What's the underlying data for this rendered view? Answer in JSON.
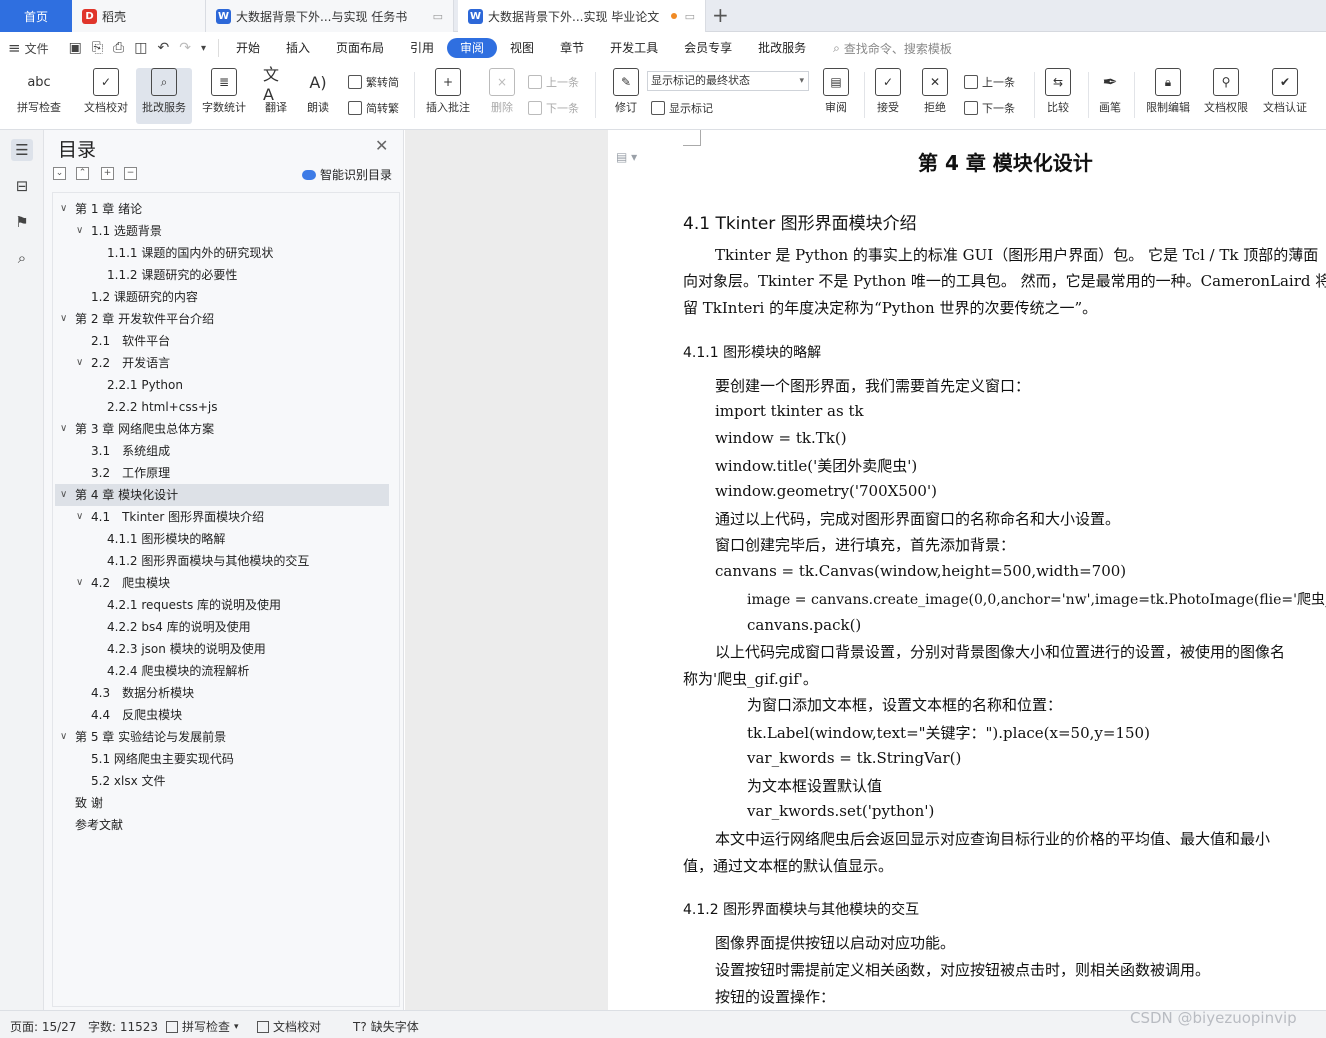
{
  "tabs": {
    "home": "首页",
    "daoke": "稻壳",
    "doc1": "大数据背景下外...与实现 任务书",
    "doc2": "大数据背景下外...实现 毕业论文"
  },
  "menu": {
    "file": "文件",
    "items": [
      "开始",
      "插入",
      "页面布局",
      "引用",
      "审阅",
      "视图",
      "章节",
      "开发工具",
      "会员专享",
      "批改服务"
    ],
    "active": "审阅",
    "search_placeholder": "查找命令、搜索模板"
  },
  "ribbon": {
    "spellcheck": "拼写检查",
    "doc_proof": "文档校对",
    "revise_service": "批改服务",
    "word_count": "字数统计",
    "translate": "翻译",
    "read_aloud": "朗读",
    "trad_to_simp": "繁转简",
    "simp_to_trad": "简转繁",
    "insert_comment": "插入批注",
    "delete": "删除",
    "prev_comment": "上一条",
    "next_comment": "下一条",
    "track_changes": "修订",
    "markup_state": "显示标记的最终状态",
    "show_markup": "显示标记",
    "review": "审阅",
    "accept": "接受",
    "reject": "拒绝",
    "prev_change": "上一条",
    "next_change": "下一条",
    "compare": "比较",
    "pen": "画笔",
    "restrict_edit": "限制编辑",
    "doc_rights": "文档权限",
    "doc_cert": "文档认证"
  },
  "toc": {
    "title": "目录",
    "smart": "智能识别目录",
    "items": [
      {
        "text": "第 1 章 绪论"
      },
      {
        "text": "1.1 选题背景"
      },
      {
        "text": "1.1.1 课题的国内外的研究现状"
      },
      {
        "text": "1.1.2 课题研究的必要性"
      },
      {
        "text": "1.2 课题研究的内容"
      },
      {
        "text": "第 2 章 开发软件平台介绍"
      },
      {
        "text": "2.1　软件平台"
      },
      {
        "text": "2.2　开发语言"
      },
      {
        "text": "2.2.1 Python"
      },
      {
        "text": "2.2.2 html+css+js"
      },
      {
        "text": "第 3 章 网络爬虫总体方案"
      },
      {
        "text": "3.1　系统组成"
      },
      {
        "text": "3.2　工作原理"
      },
      {
        "text": "第 4 章 模块化设计"
      },
      {
        "text": "4.1　Tkinter 图形界面模块介绍"
      },
      {
        "text": "4.1.1 图形模块的略解"
      },
      {
        "text": "4.1.2 图形界面模块与其他模块的交互"
      },
      {
        "text": "4.2　爬虫模块"
      },
      {
        "text": "4.2.1 requests 库的说明及使用"
      },
      {
        "text": "4.2.2 bs4 库的说明及使用"
      },
      {
        "text": "4.2.3 json 模块的说明及使用"
      },
      {
        "text": "4.2.4 爬虫模块的流程解析"
      },
      {
        "text": "4.3　数据分析模块"
      },
      {
        "text": "4.4　反爬虫模块"
      },
      {
        "text": "第 5 章 实验结论与发展前景"
      },
      {
        "text": "5.1 网络爬虫主要实现代码"
      },
      {
        "text": "5.2 xlsx 文件"
      },
      {
        "text": "致 谢"
      },
      {
        "text": "参考文献"
      }
    ]
  },
  "doc": {
    "chapter": "第 4 章 模块化设计",
    "s41": "4.1  Tkinter 图形界面模块介绍",
    "p1a": "Tkinter 是 Python 的事实上的标准 GUI（图形用户界面）包。 它是 Tcl / Tk 顶部的薄面",
    "p1b": "向对象层。Tkinter 不是 Python 唯一的工具包。 然而，它是最常用的一种。CameronLaird 将保",
    "p1c": "留 TkInteri 的年度决定称为“Python 世界的次要传统之一”。",
    "s411": "4.1.1 图形模块的略解",
    "l1": "要创建一个图形界面，我们需要首先定义窗口：",
    "l2": "import tkinter as tk",
    "l3": "window = tk.Tk()",
    "l4": "window.title('美团外卖爬虫')",
    "l5": "window.geometry('700X500')",
    "l6": "通过以上代码，完成对图形界面窗口的名称命名和大小设置。",
    "l7": "窗口创建完毕后，进行填充，首先添加背景：",
    "l8": "canvans = tk.Canvas(window,height=500,width=700)",
    "l9": "image = canvans.create_image(0,0,anchor='nw',image=tk.PhotoImage(flie='爬虫_gif.gif')",
    "l10": "canvans.pack()",
    "l11a": "以上代码完成窗口背景设置，分别对背景图像大小和位置进行的设置，被使用的图像名",
    "l11b": "称为'爬虫_gif.gif'。",
    "l12": "为窗口添加文本框，设置文本框的名称和位置：",
    "l13": "tk.Label(window,text=\"关键字：\").place(x=50,y=150)",
    "l14": "var_kwords = tk.StringVar()",
    "l15": "为文本框设置默认值",
    "l16": "var_kwords.set('python')",
    "l17a": "本文中运行网络爬虫后会返回显示对应查询目标行业的价格的平均值、最大值和最小",
    "l17b": "值，通过文本框的默认值显示。",
    "s412": "4.1.2 图形界面模块与其他模块的交互",
    "l18": "图像界面提供按钮以启动对应功能。",
    "l19": "设置按钮时需提前定义相关函数，对应按钮被点击时，则相关函数被调用。",
    "l20": "按钮的设置操作："
  },
  "status": {
    "page": "页面: 15/27",
    "words": "字数: 11523",
    "spell": "拼写检查",
    "proof": "文档校对",
    "missing_font": "缺失字体"
  },
  "watermark": "CSDN @biyezuopinvip"
}
